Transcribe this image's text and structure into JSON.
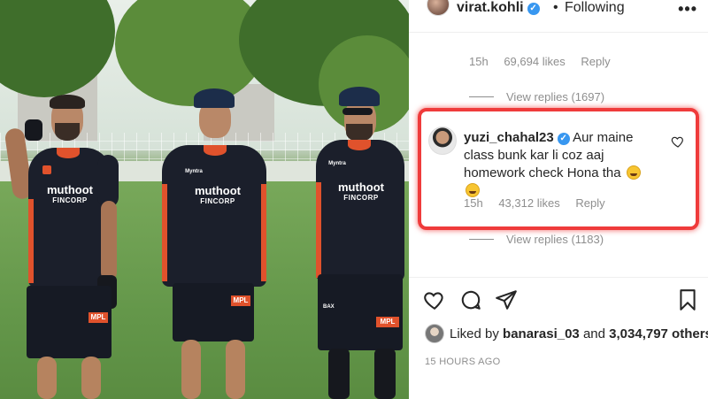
{
  "post": {
    "author": "virat.kohli",
    "separator": "•",
    "follow_status": "Following",
    "more": "•••"
  },
  "jersey": {
    "sponsor_main": "muthoot",
    "sponsor_sub": "FINCORP",
    "chest_label": "Myntra",
    "patch": "MPL",
    "sleeve_brand": "BAX"
  },
  "comment_prev": {
    "time": "15h",
    "likes": "69,694 likes",
    "reply": "Reply",
    "view_replies": "View replies (1697)"
  },
  "comment_main": {
    "username": "yuzi_chahal23",
    "text": "Aur maine class bunk kar li coz aaj homework check Hona tha",
    "time": "15h",
    "likes": "43,312 likes",
    "reply": "Reply",
    "view_replies": "View replies (1183)"
  },
  "likes": {
    "prefix": "Liked by ",
    "user": "banarasi_03",
    "middle": " and ",
    "count": "3,034,797 others"
  },
  "timestamp": "15 HOURS AGO",
  "colors": {
    "highlight": "#ef3b3b",
    "verified": "#3897f0",
    "muted": "#8e8e8e"
  }
}
